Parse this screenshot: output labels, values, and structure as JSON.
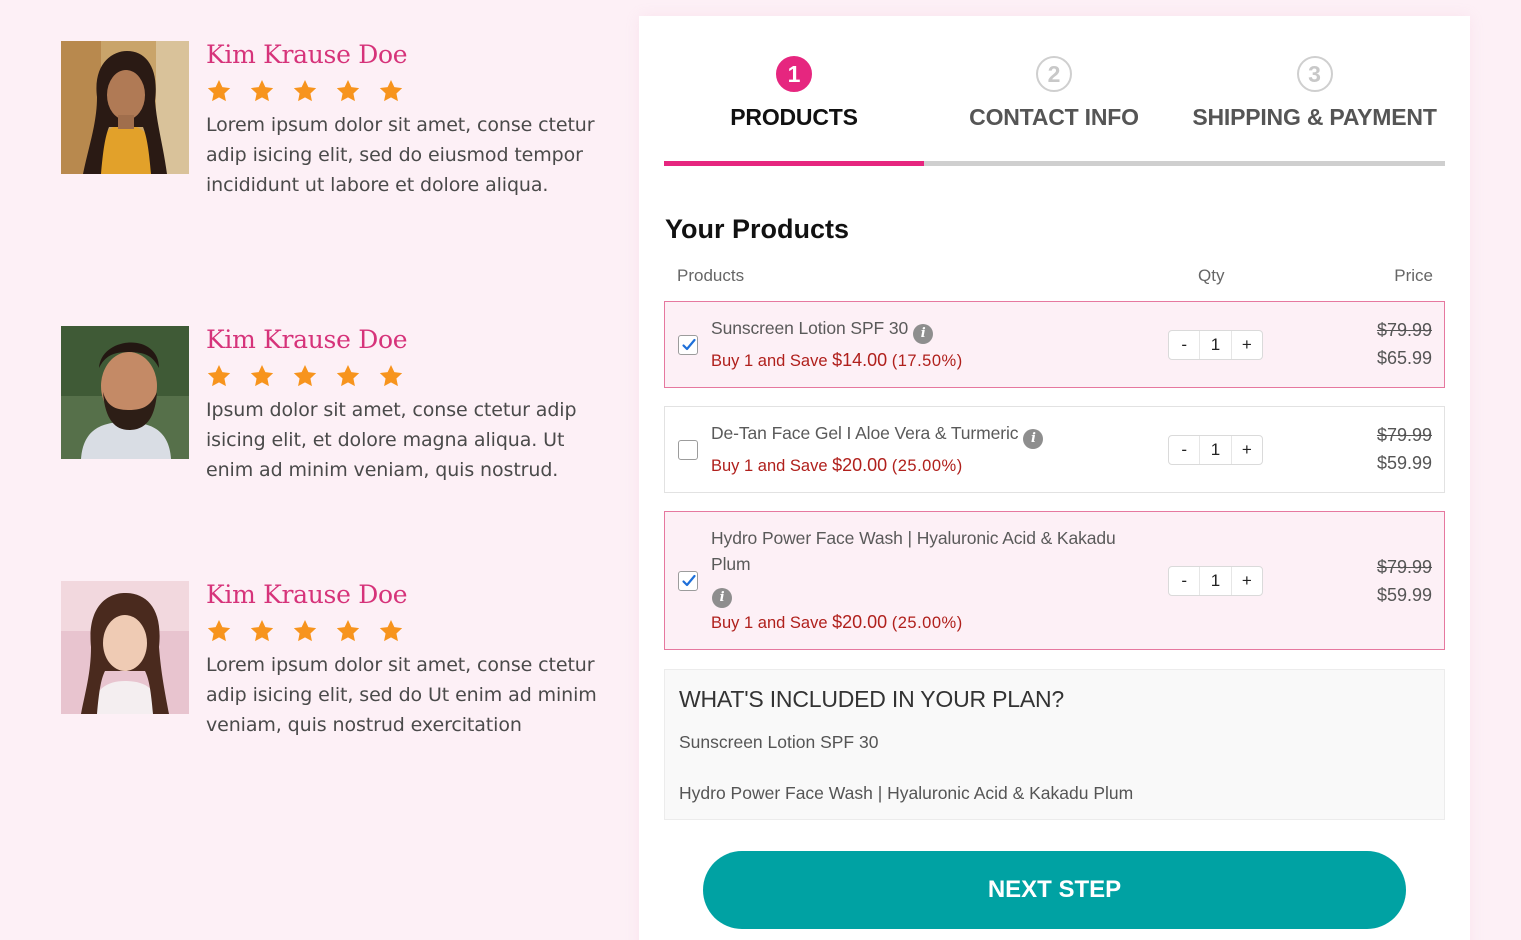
{
  "testimonials": [
    {
      "name": "Kim Krause Doe",
      "rating": 5,
      "text": "Lorem ipsum dolor sit amet, conse ctetur adip isicing elit, sed do eiusmod tempor incididunt ut labore et dolore aliqua."
    },
    {
      "name": "Kim Krause Doe",
      "rating": 5,
      "text": "Ipsum dolor sit amet, conse ctetur adip isicing elit, et dolore magna aliqua. Ut enim ad minim veniam, quis nostrud."
    },
    {
      "name": "Kim Krause Doe",
      "rating": 5,
      "text": "Lorem ipsum dolor sit amet, conse ctetur adip isicing elit, sed do Ut enim ad minim veniam, quis nostrud exercitation"
    }
  ],
  "steps": [
    {
      "number": "1",
      "label": "PRODUCTS",
      "active": true
    },
    {
      "number": "2",
      "label": "CONTACT INFO",
      "active": false
    },
    {
      "number": "3",
      "label": "SHIPPING & PAYMENT",
      "active": false
    }
  ],
  "products_section": {
    "title": "Your Products",
    "headers": {
      "product": "Products",
      "qty": "Qty",
      "price": "Price"
    },
    "items": [
      {
        "name": "Sunscreen Lotion SPF 30",
        "checked": true,
        "save_prefix": "Buy 1 and Save",
        "save_amount": "$14.00",
        "save_percent": "(17.50%)",
        "qty": "1",
        "old_price": "$79.99",
        "price": "$65.99"
      },
      {
        "name": "De-Tan Face Gel I Aloe Vera & Turmeric",
        "checked": false,
        "save_prefix": "Buy 1 and Save",
        "save_amount": "$20.00",
        "save_percent": "(25.00%)",
        "qty": "1",
        "old_price": "$79.99",
        "price": "$59.99"
      },
      {
        "name_line1": "Hydro Power Face Wash | Hyaluronic Acid & Kakadu",
        "name_line2": "Plum",
        "checked": true,
        "save_prefix": "Buy 1 and Save",
        "save_amount": "$20.00",
        "save_percent": "(25.00%)",
        "qty": "1",
        "old_price": "$79.99",
        "price": "$59.99"
      }
    ],
    "qty_minus": "-",
    "qty_plus": "+",
    "info_glyph": "i"
  },
  "plan": {
    "heading": "WHAT'S INCLUDED IN YOUR PLAN?",
    "items": [
      "Sunscreen Lotion SPF 30",
      "Hydro Power Face Wash | Hyaluronic Acid & Kakadu Plum"
    ]
  },
  "next_button": "NEXT STEP",
  "colors": {
    "accent": "#e6267f",
    "name": "#d6337a",
    "star": "#f7941d",
    "button": "#00a2a3",
    "save": "#b0201c"
  }
}
